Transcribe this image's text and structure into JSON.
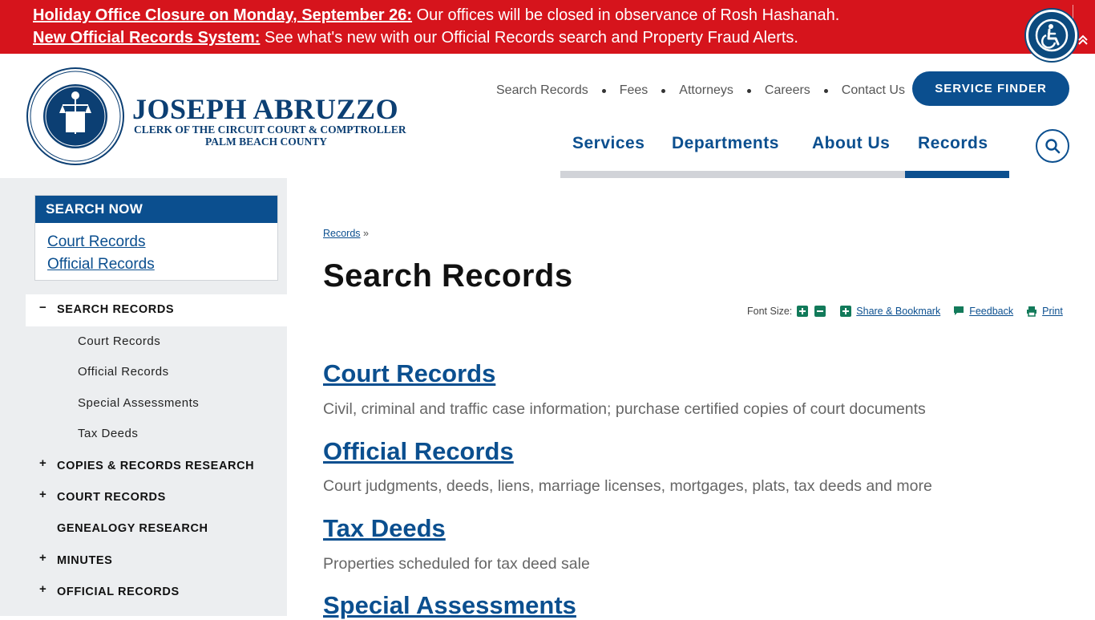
{
  "alerts": [
    {
      "link": "Holiday Office Closure on Monday, September 26:",
      "text": " Our offices will be closed in observance of Rosh Hashanah."
    },
    {
      "link": "New Official Records System:",
      "text": " See what's new with our Official Records search and Property Fraud Alerts."
    }
  ],
  "brand": {
    "name": "JOSEPH ABRUZZO",
    "subtitle1": "CLERK OF THE CIRCUIT COURT & COMPTROLLER",
    "subtitle2": "PALM BEACH COUNTY"
  },
  "utility_nav": [
    "Search Records",
    "Fees",
    "Attorneys",
    "Careers",
    "Contact Us"
  ],
  "service_finder": "SERVICE FINDER",
  "main_nav": [
    "Services",
    "Departments",
    "About Us",
    "Records"
  ],
  "sidebar": {
    "search_now": {
      "heading": "SEARCH NOW",
      "links": [
        "Court Records",
        "Official Records"
      ]
    },
    "nav": {
      "active": {
        "toggle": "−",
        "label": "SEARCH RECORDS"
      },
      "sub_items": [
        "Court Records",
        "Official Records",
        "Special Assessments",
        "Tax Deeds"
      ],
      "items": [
        {
          "toggle": "+",
          "label": "COPIES & RECORDS RESEARCH"
        },
        {
          "toggle": "+",
          "label": "COURT RECORDS"
        },
        {
          "toggle": "",
          "label": "GENEALOGY RESEARCH"
        },
        {
          "toggle": "+",
          "label": "MINUTES"
        },
        {
          "toggle": "+",
          "label": "OFFICIAL RECORDS"
        }
      ]
    }
  },
  "breadcrumb": {
    "link": "Records",
    "sep": " »"
  },
  "page_title": "Search Records",
  "tools": {
    "font_size": "Font Size:",
    "share": "Share & Bookmark",
    "feedback": "Feedback",
    "print": "Print"
  },
  "results": [
    {
      "title": "Court Records",
      "desc": "Civil, criminal and traffic case information; purchase certified copies of court documents"
    },
    {
      "title": "Official Records",
      "desc": "Court judgments, deeds, liens, marriage licenses, mortgages, plats, tax deeds and more"
    },
    {
      "title": "Tax Deeds",
      "desc": "Properties scheduled for tax deed sale"
    },
    {
      "title": "Special Assessments",
      "desc": ""
    }
  ]
}
